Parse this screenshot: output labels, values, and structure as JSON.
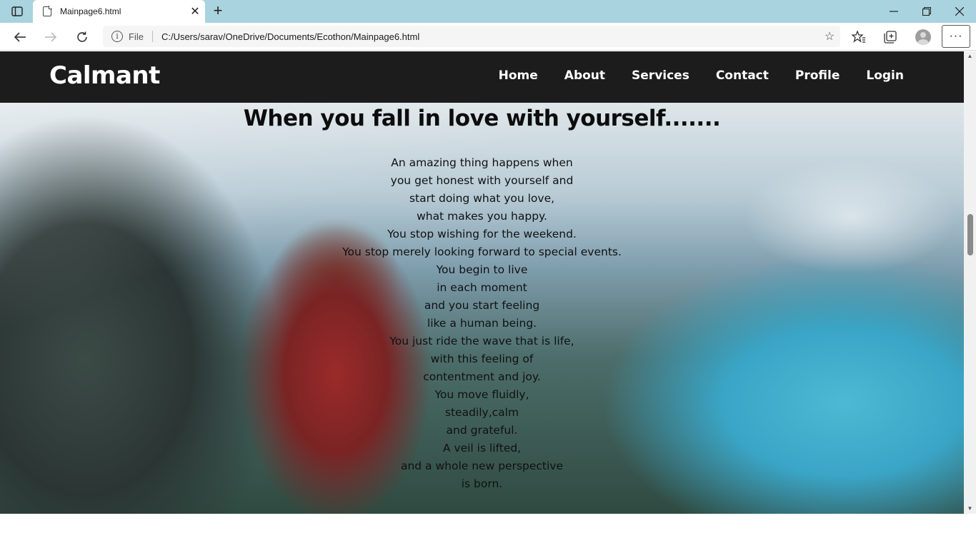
{
  "browser": {
    "tab_title": "Mainpage6.html",
    "new_tab_symbol": "+",
    "address_prefix": "File",
    "url": "C:/Users/sarav/OneDrive/Documents/Ecothon/Mainpage6.html",
    "more_symbol": "···"
  },
  "site": {
    "brand": "Calmant",
    "nav": [
      "Home",
      "About",
      "Services",
      "Contact",
      "Profile",
      "Login"
    ]
  },
  "content": {
    "heading": "When you fall in love with yourself.......",
    "poem": [
      "An amazing thing happens when",
      "you get honest with yourself and",
      "start doing what you love,",
      "what makes you happy.",
      "You stop wishing for the weekend.",
      "You stop merely looking forward to special events.",
      "You begin to live",
      "in each moment",
      "and you start feeling",
      "like a human being.",
      "You just ride the wave that is life,",
      "with this feeling of",
      "contentment and joy.",
      "You move fluidly,",
      "steadily,calm",
      "and grateful.",
      "A veil is lifted,",
      "and a whole new perspective",
      "is born."
    ]
  },
  "colors": {
    "tabbar": "#a9d3de",
    "site_nav_bg": "#1c1c1c",
    "text_dark": "#0d0d0d"
  }
}
